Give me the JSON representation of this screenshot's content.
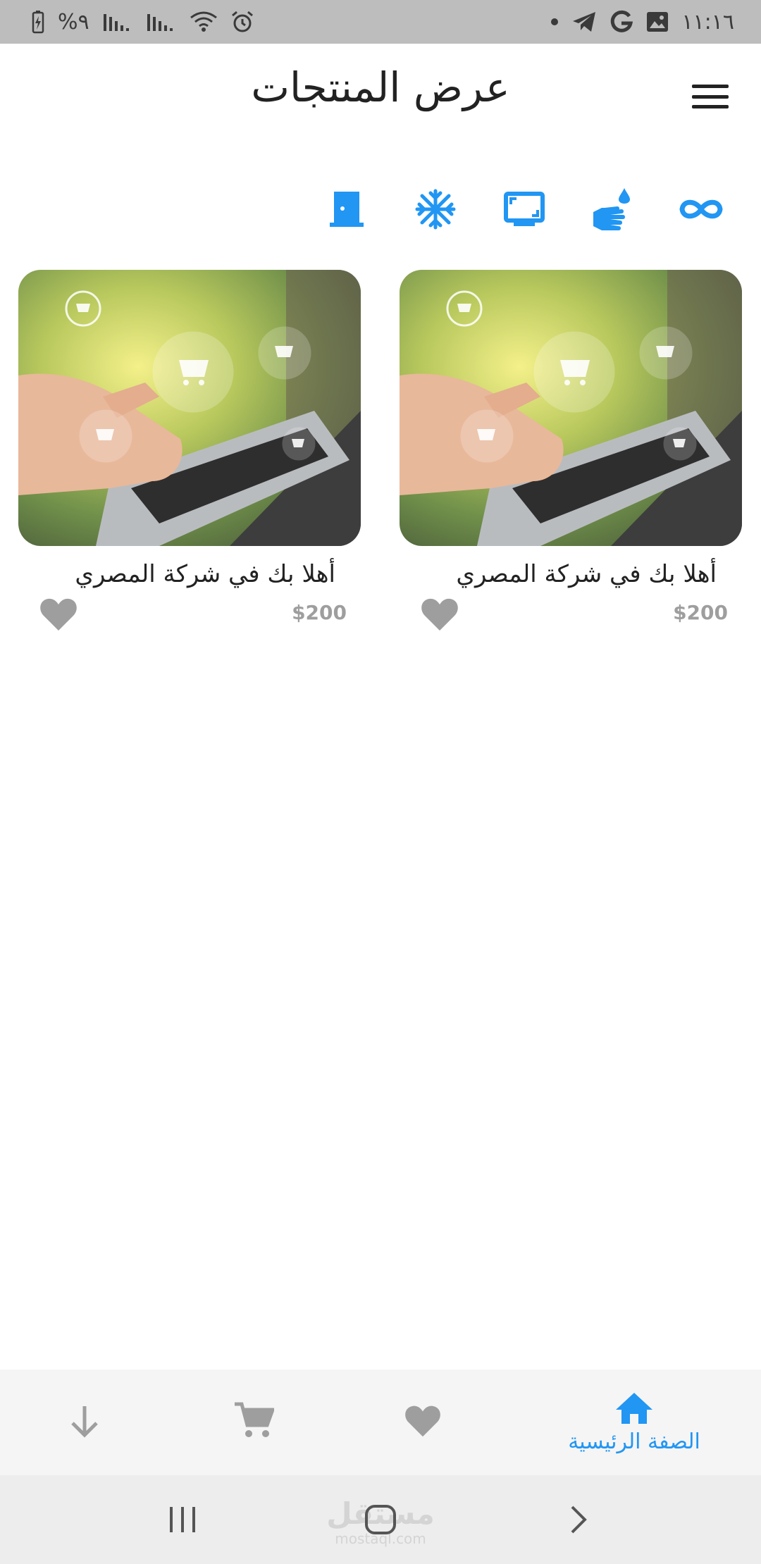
{
  "status_bar": {
    "time": "١١:١٦",
    "battery_percent": "%٩",
    "icons": [
      "gallery-icon",
      "g-icon",
      "telegram-icon",
      "dot-icon",
      "alarm-icon",
      "wifi-icon",
      "signal-icon",
      "signal-icon",
      "battery-icon"
    ]
  },
  "app_bar": {
    "title": "عرض المنتجات",
    "menu_icon": "hamburger-menu-icon"
  },
  "categories": [
    {
      "icon": "infinity-icon"
    },
    {
      "icon": "hand-wash-icon"
    },
    {
      "icon": "tv-icon"
    },
    {
      "icon": "snowflake-icon"
    },
    {
      "icon": "door-icon"
    }
  ],
  "products": [
    {
      "title": "أهلا بك في شركة المصري",
      "price": "$200",
      "image": "laptop-shopping-cart-photo",
      "favorite": false
    },
    {
      "title": "أهلا بك في شركة المصري",
      "price": "$200",
      "image": "laptop-shopping-cart-photo",
      "favorite": false
    }
  ],
  "bottom_nav": {
    "home_label": "الصفة الرئيسية",
    "items": [
      "home-icon",
      "heart-icon",
      "cart-icon",
      "download-arrow-icon"
    ]
  },
  "watermark": {
    "text": "مستقل",
    "sub": "mostaql.com"
  },
  "colors": {
    "accent": "#2196f3",
    "status_bar": "#bdbdbd",
    "text": "#222222",
    "muted": "#9e9e9e",
    "bottom_nav_bg": "#f5f5f5"
  }
}
